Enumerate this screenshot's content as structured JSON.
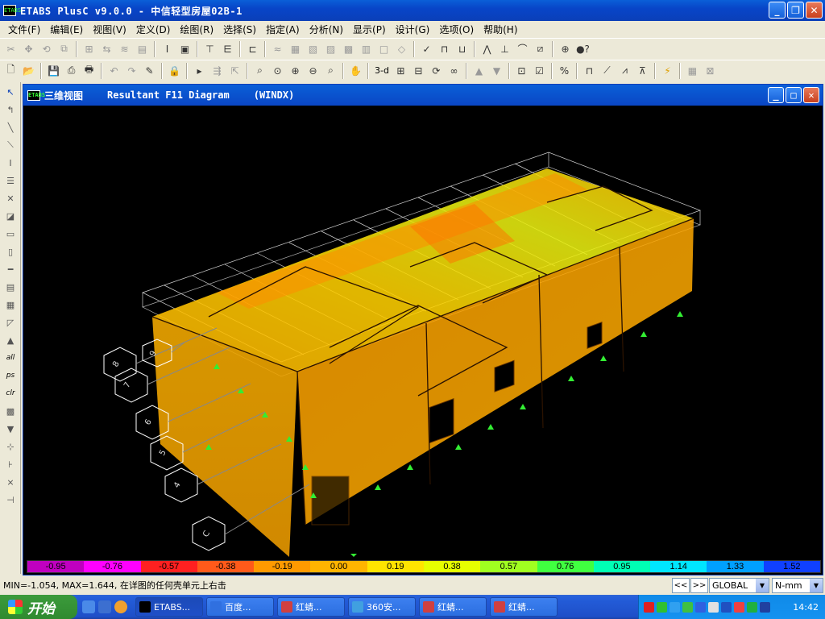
{
  "window": {
    "title": "ETABS PlusC v9.0.0 - 中信轻型房屋02B-1",
    "icon_text": "ETABS"
  },
  "menu": [
    "文件(F)",
    "编辑(E)",
    "视图(V)",
    "定义(D)",
    "绘图(R)",
    "选择(S)",
    "指定(A)",
    "分析(N)",
    "显示(P)",
    "设计(G)",
    "选项(O)",
    "帮助(H)"
  ],
  "toolbar2": {
    "view3d_label": "3-d"
  },
  "child_window": {
    "name": "三维视图",
    "diagram": "Resultant F11 Diagram",
    "load_case": "(WINDX)"
  },
  "viewport": {
    "background": "#000000",
    "grid_bubbles": [
      "C",
      "4",
      "5",
      "6",
      "7",
      "8",
      "9"
    ]
  },
  "colorbar": {
    "values": [
      "-0.95",
      "-0.76",
      "-0.57",
      "-0.38",
      "-0.19",
      "0.00",
      "0.19",
      "0.38",
      "0.57",
      "0.76",
      "0.95",
      "1.14",
      "1.33",
      "1.52"
    ],
    "colors": [
      "#c000c0",
      "#ff00ff",
      "#ff2020",
      "#ff5a1a",
      "#ff9a00",
      "#ffb400",
      "#ffe400",
      "#e6ff00",
      "#a0ff20",
      "#40ff40",
      "#00ffb4",
      "#00e6ff",
      "#00a0ff",
      "#1040ff"
    ]
  },
  "status": {
    "message": "MIN=-1.054, MAX=1.644, 在详图的任何壳单元上右击",
    "prev_label": "<<",
    "next_label": ">>",
    "coord_system": "GLOBAL",
    "units": "N-mm"
  },
  "taskbar": {
    "start_label": "开始",
    "tasks": [
      {
        "label": "ETABS...",
        "active": true
      },
      {
        "label": "百度...",
        "active": false
      },
      {
        "label": "红蜻...",
        "active": false
      },
      {
        "label": "360安...",
        "active": false
      },
      {
        "label": "红蜻...",
        "active": false
      },
      {
        "label": "红蜻...",
        "active": false
      }
    ],
    "clock": "14:42"
  }
}
